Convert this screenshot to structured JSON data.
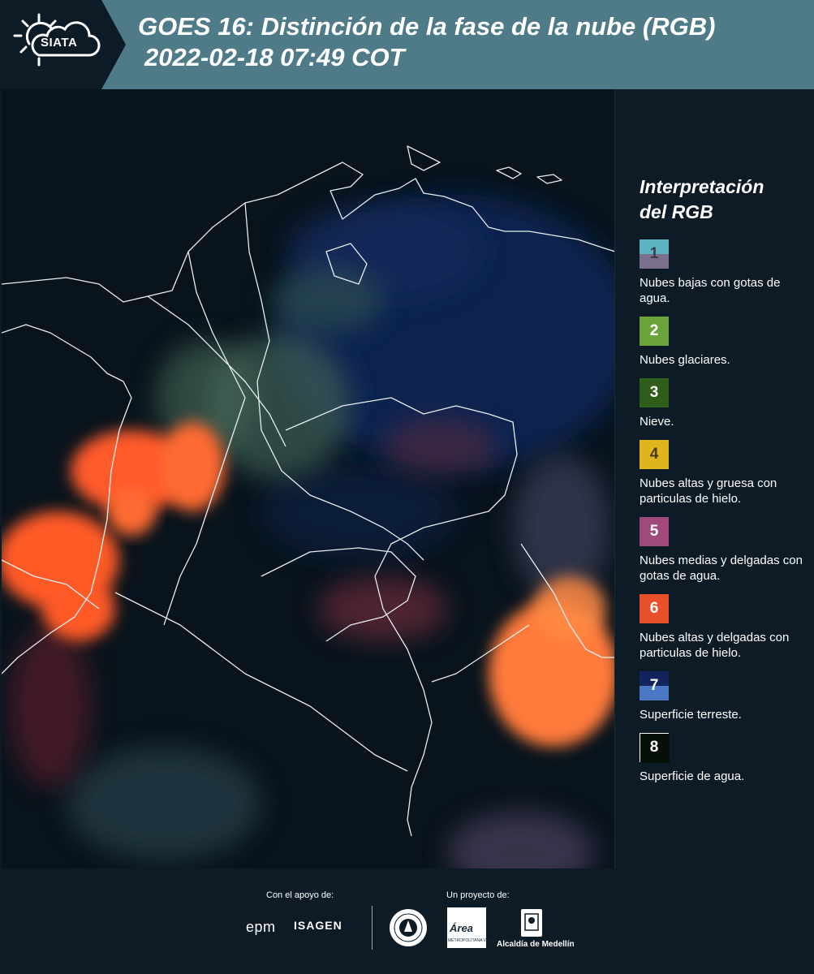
{
  "header": {
    "logo_text": "SIATA",
    "title_line1": "GOES 16: Distinción de la fase de la nube (RGB)",
    "title_line2": "2022-02-18 07:49 COT",
    "background_color": "#4f7b89"
  },
  "legend": {
    "title_line1": "Interpretación",
    "title_line2": "del RGB",
    "items": [
      {
        "number": "1",
        "label": "Nubes bajas con gotas de agua.",
        "color_top": "#5fb4c4",
        "color_bottom": "#7a6f8d",
        "number_color": "#3a3a4a"
      },
      {
        "number": "2",
        "label": "Nubes glaciares.",
        "color_top": "#6aa43a",
        "color_bottom": "#6aa43a",
        "number_color": "#ffffff"
      },
      {
        "number": "3",
        "label": "Nieve.",
        "color_top": "#2f5e1a",
        "color_bottom": "#2f5e1a",
        "number_color": "#ffffff"
      },
      {
        "number": "4",
        "label": "Nubes altas y gruesa con particulas de hielo.",
        "color_top": "#e0b41c",
        "color_bottom": "#e0b41c",
        "number_color": "#4a3a10"
      },
      {
        "number": "5",
        "label": "Nubes medias y delgadas con gotas de agua.",
        "color_top": "#a04a7c",
        "color_bottom": "#a04a7c",
        "number_color": "#ffffff"
      },
      {
        "number": "6",
        "label": "Nubes altas y delgadas con particulas de hielo.",
        "color_top": "#e8502a",
        "color_bottom": "#e8502a",
        "number_color": "#ffffff"
      },
      {
        "number": "7",
        "label": "Superficie terreste.",
        "color_top": "#13245c",
        "color_bottom": "#4a78c4",
        "number_color": "#ffffff"
      },
      {
        "number": "8",
        "label": "Superficie de agua.",
        "color_top": "#061008",
        "color_bottom": "#061008",
        "number_color": "#ffffff"
      }
    ]
  },
  "footer": {
    "support_label": "Con el apoyo de:",
    "project_label": "Un proyecto de:",
    "epm": "epm",
    "isagen": "ISAGEN",
    "area_logo_text": "Área",
    "area_sub": "METROPOLITANA Valle de Aburrá",
    "alcaldia": "Alcaldía de Medellín"
  }
}
